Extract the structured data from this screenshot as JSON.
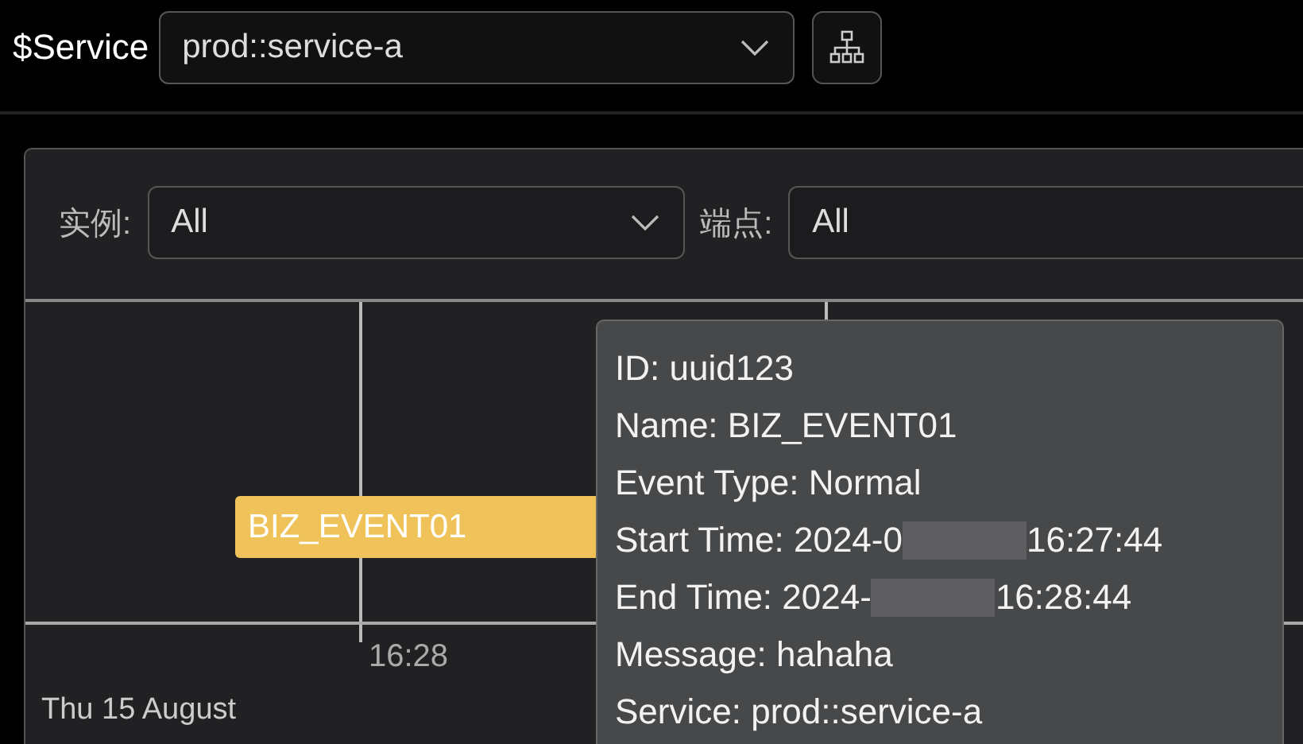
{
  "toolbar": {
    "label": "$Service",
    "service_select": {
      "value": "prod::service-a"
    }
  },
  "filters": [
    {
      "label": "实例:",
      "value": "All",
      "has_caret": true
    },
    {
      "label": "端点:",
      "value": "All",
      "has_caret": false
    }
  ],
  "timeline": {
    "event": {
      "label": "BIZ_EVENT01",
      "color": "#f0c35a"
    },
    "tick": "16:28",
    "date": "Thu 15 August"
  },
  "tooltip": {
    "lines": [
      {
        "kind": "plain",
        "text": "ID: uuid123"
      },
      {
        "kind": "plain",
        "text": "Name: BIZ_EVENT01"
      },
      {
        "kind": "plain",
        "text": "Event Type: Normal"
      },
      {
        "kind": "redacted",
        "text": "Start Time: 2024-0",
        "after": "16:27:44"
      },
      {
        "kind": "redacted",
        "text": "End Time: 2024-",
        "after": "16:28:44"
      },
      {
        "kind": "plain",
        "text": "Message: hahaha"
      },
      {
        "kind": "plain",
        "text": "Service: prod::service-a"
      }
    ]
  }
}
